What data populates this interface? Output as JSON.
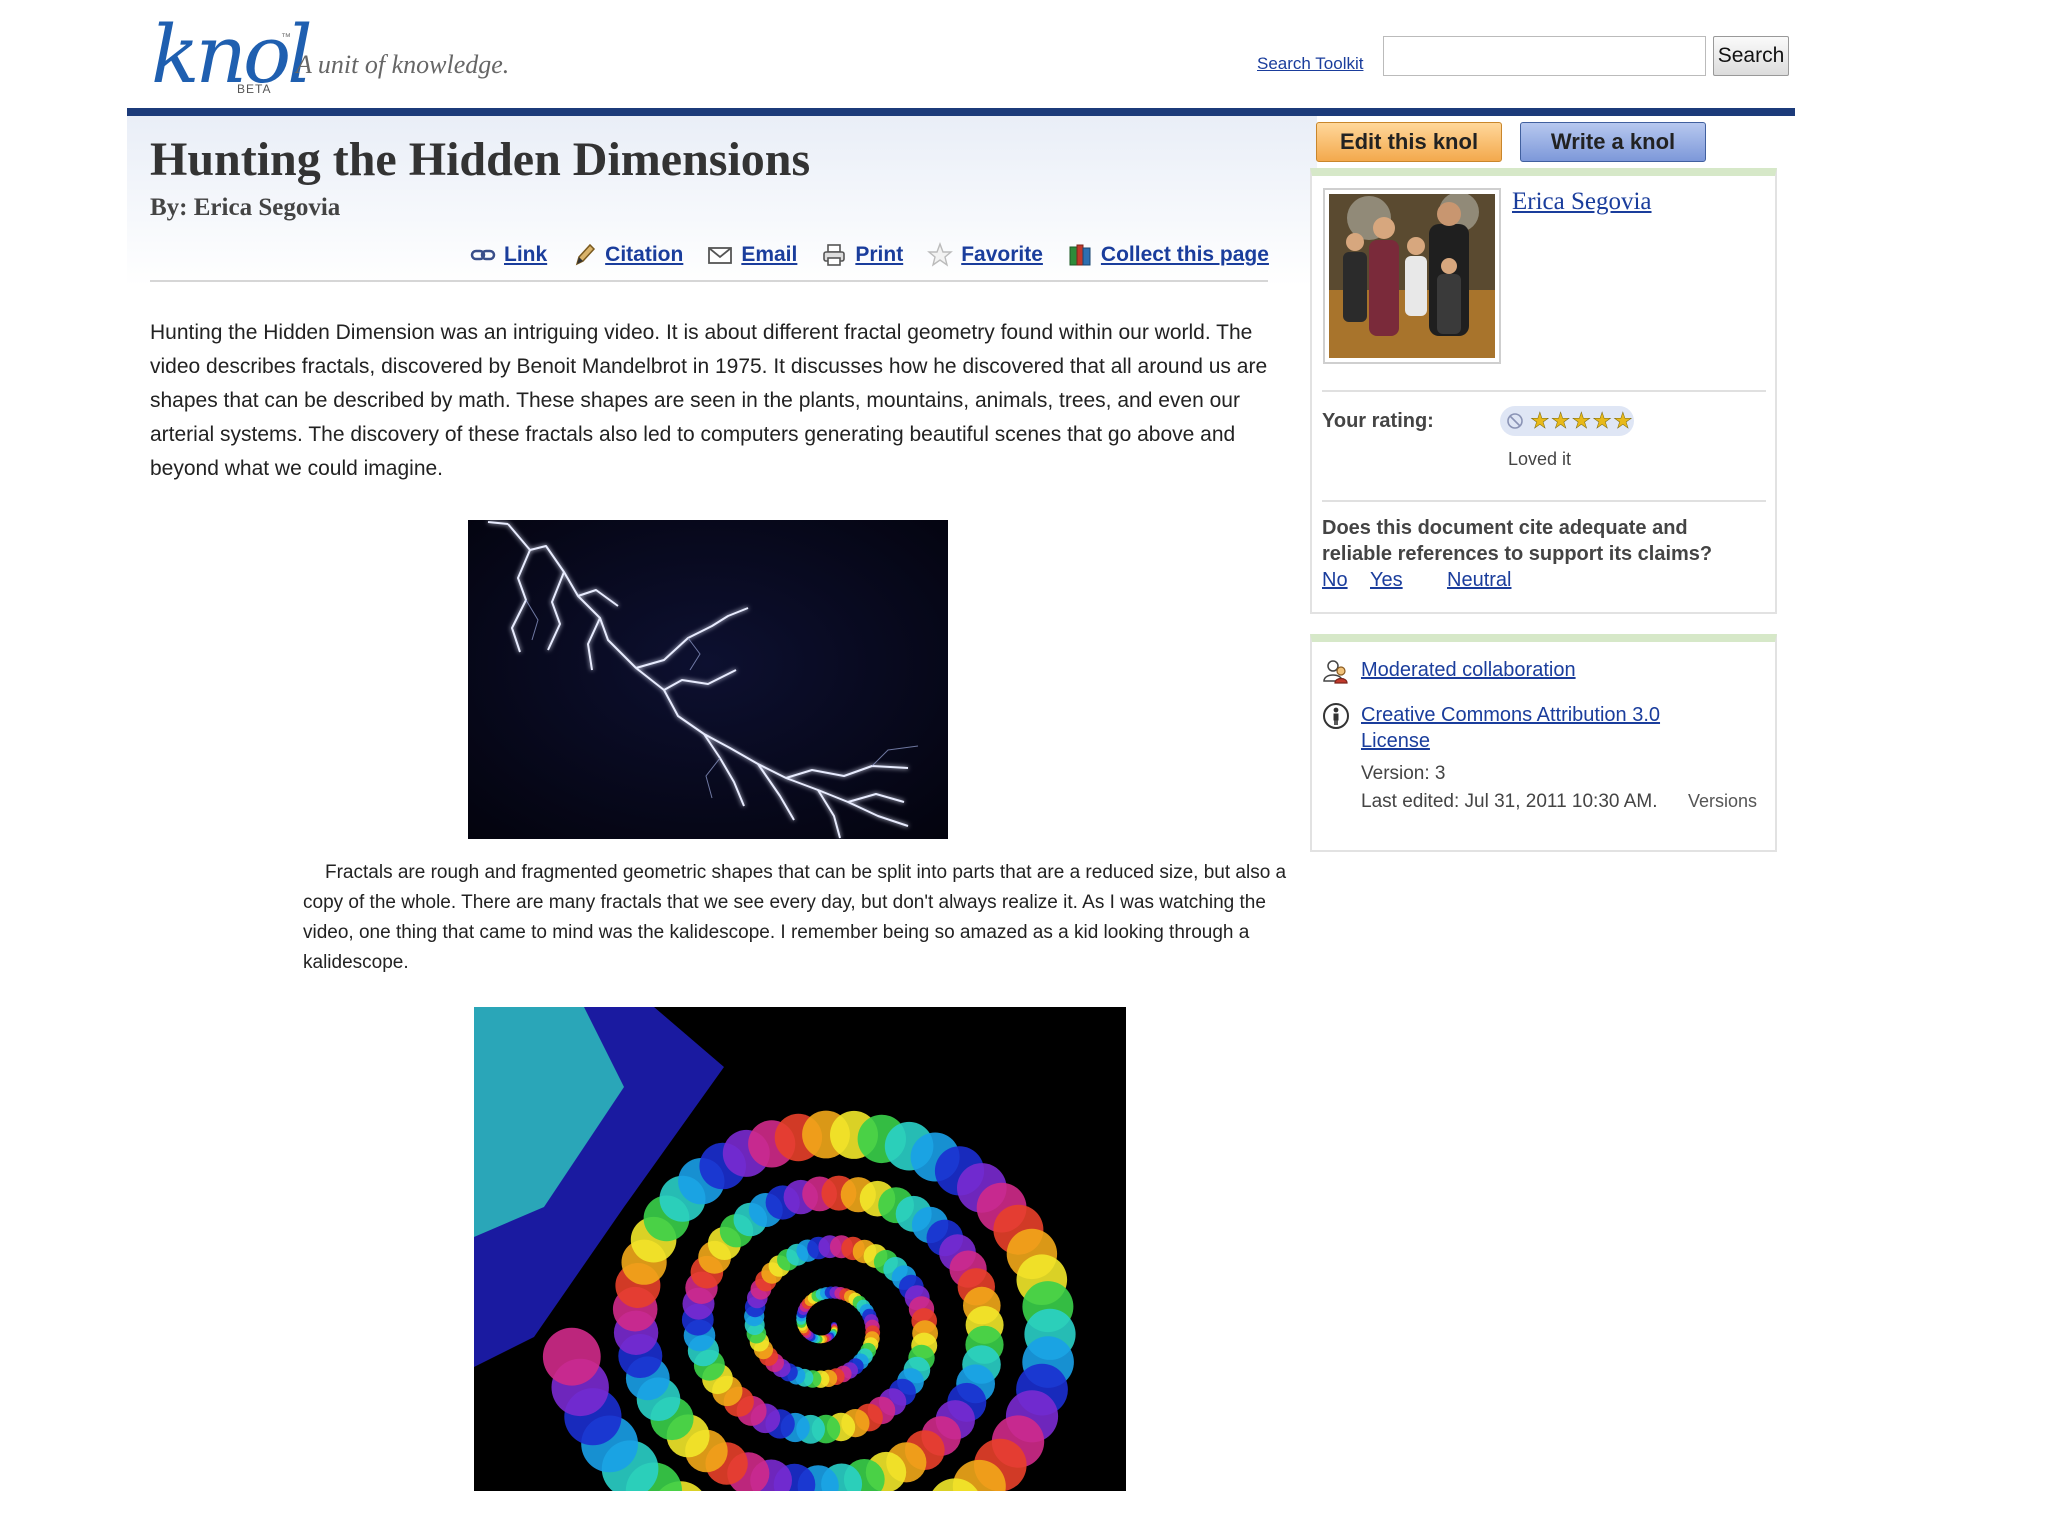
{
  "header": {
    "logo_text": "knol",
    "logo_tm": "™",
    "logo_beta": "BETA",
    "tagline": "A unit of knowledge.",
    "search_toolkit_label": "Search Toolkit",
    "search_value": "",
    "search_button_label": "Search"
  },
  "article": {
    "title": "Hunting the Hidden Dimensions",
    "byline": "By: Erica Segovia",
    "toolbar": {
      "link_label": "Link",
      "citation_label": "Citation",
      "email_label": "Email",
      "print_label": "Print",
      "favorite_label": "Favorite",
      "collect_label": "Collect this page"
    },
    "paragraph1": "Hunting the Hidden Dimension was an intriguing video. It is about different fractal geometry found within our world. The video describes fractals, discovered by Benoit Mandelbrot in 1975. It discusses how he discovered that all around us are shapes that can be described by math. These shapes are seen in the plants, mountains, animals, trees, and even our arterial systems. The discovery of these fractals also led to computers generating beautiful scenes that go above and beyond what we could imagine.",
    "paragraph2": "Fractals are rough and fragmented geometric shapes that can be split into parts that are a reduced size, but also a copy of the whole. There are many fractals that we see every day, but don't always realize it. As I was watching the video, one thing that came to mind was the kalidescope. I remember being so amazed as a kid looking through a kalidescope."
  },
  "sidebar": {
    "edit_button_label": "Edit this knol",
    "write_button_label": "Write a knol",
    "author_name": "Erica Segovia",
    "rating": {
      "label": "Your rating:",
      "stars_selected": 5,
      "stars_total": 5,
      "caption": "Loved it"
    },
    "references": {
      "question": "Does this document cite adequate and reliable references to support its claims?",
      "no_label": "No",
      "yes_label": "Yes",
      "neutral_label": "Neutral"
    },
    "collaboration_link": "Moderated collaboration",
    "license_link": "Creative Commons Attribution 3.0 License",
    "version": "Version: 3",
    "last_edited": "Last edited: Jul 31, 2011 10:30 AM.",
    "versions_label": "Versions"
  },
  "colors": {
    "topbar": "#1c3b7a",
    "link": "#1a3d9c",
    "edit_button": "#f3a94d",
    "write_button": "#7d98d9",
    "box_accent": "#d6e8c8"
  },
  "icons": {
    "link": "chain-link-icon",
    "citation": "pen-icon",
    "email": "envelope-icon",
    "print": "printer-icon",
    "favorite": "star-icon",
    "collect": "books-icon",
    "collaboration": "people-icon",
    "license": "creative-commons-icon",
    "rating_clear": "no-rating-icon"
  }
}
